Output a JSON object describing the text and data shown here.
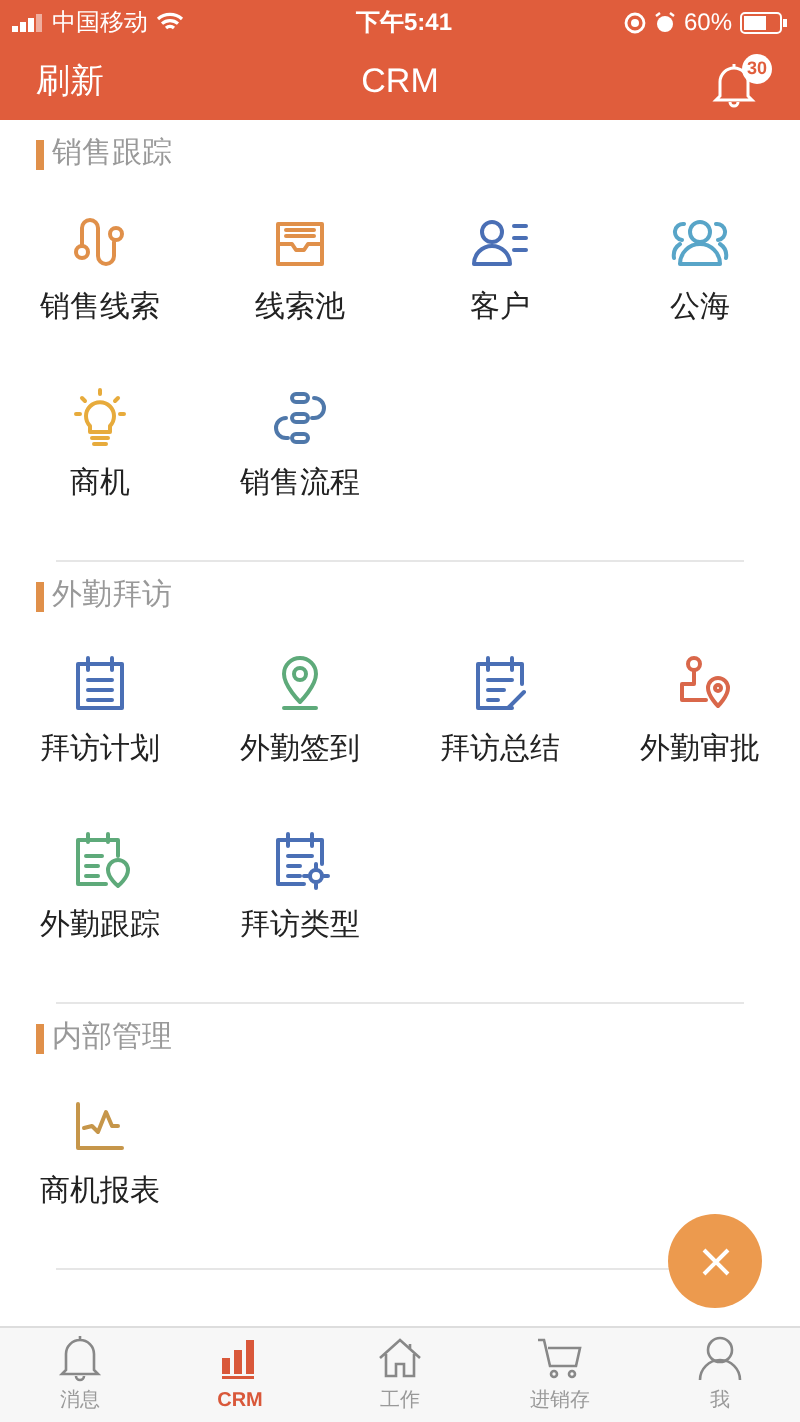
{
  "status_bar": {
    "carrier": "中国移动",
    "time": "下午5:41",
    "battery": "60%"
  },
  "header": {
    "left": "刷新",
    "title": "CRM",
    "badge": "30"
  },
  "sections": [
    {
      "title": "销售跟踪",
      "items": [
        "销售线索",
        "线索池",
        "客户",
        "公海",
        "商机",
        "销售流程"
      ]
    },
    {
      "title": "外勤拜访",
      "items": [
        "拜访计划",
        "外勤签到",
        "拜访总结",
        "外勤审批",
        "外勤跟踪",
        "拜访类型"
      ]
    },
    {
      "title": "内部管理",
      "items": [
        "商机报表"
      ]
    }
  ],
  "tabs": [
    {
      "label": "消息",
      "selected": false
    },
    {
      "label": "CRM",
      "selected": true
    },
    {
      "label": "工作",
      "selected": false
    },
    {
      "label": "进销存",
      "selected": false
    },
    {
      "label": "我",
      "selected": false
    }
  ]
}
